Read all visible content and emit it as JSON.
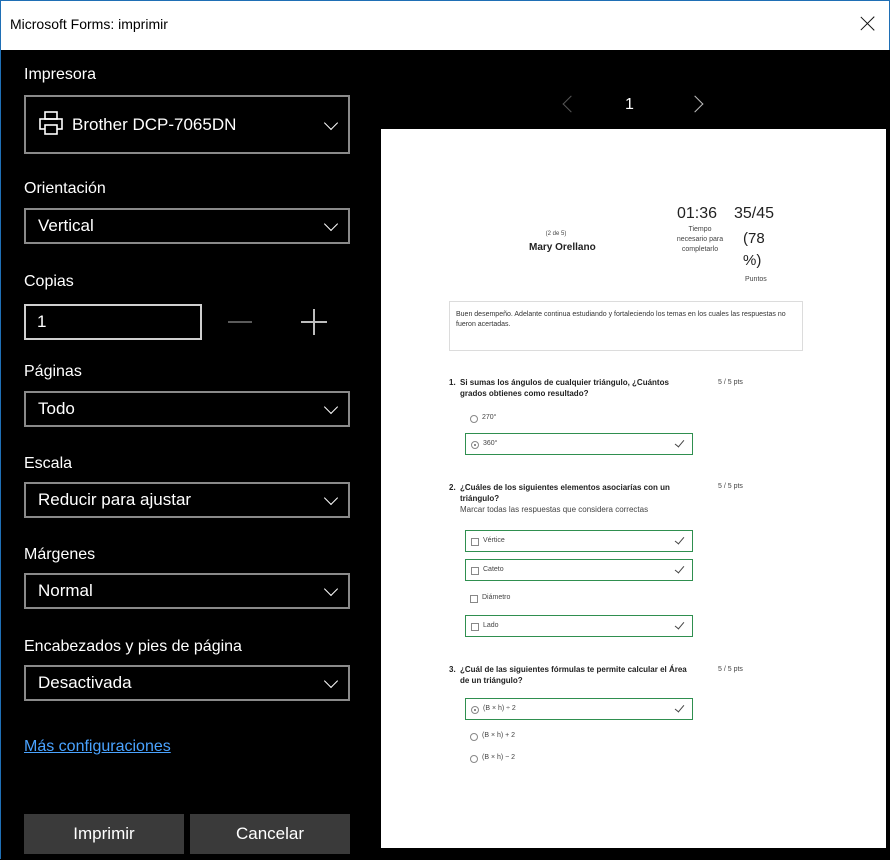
{
  "window": {
    "title": "Microsoft Forms: imprimir"
  },
  "settings": {
    "printer_label": "Impresora",
    "printer_value": "Brother DCP-7065DN",
    "orientation_label": "Orientación",
    "orientation_value": "Vertical",
    "copies_label": "Copias",
    "copies_value": "1",
    "pages_label": "Páginas",
    "pages_value": "Todo",
    "scale_label": "Escala",
    "scale_value": "Reducir para ajustar",
    "margins_label": "Márgenes",
    "margins_value": "Normal",
    "headers_label": "Encabezados y pies de página",
    "headers_value": "Desactivada",
    "more_settings": "Más configuraciones",
    "print_button": "Imprimir",
    "cancel_button": "Cancelar"
  },
  "preview": {
    "page_number": "1",
    "header": {
      "count": "(2 de 5)",
      "name": "Mary Orellano",
      "time": "01:36",
      "time_label": "Tiempo necesario para completarlo",
      "score": "35/45",
      "percent": "(78 %)",
      "points_label": "Puntos"
    },
    "feedback": "Buen desempeño. Adelante continua estudiando y fortaleciendo los temas en los cuales las respuestas no fueron acertadas.",
    "q1": {
      "num": "1.",
      "text": "Si sumas los ángulos de cualquier triángulo, ¿Cuántos grados obtienes como resultado?",
      "points": "5   / 5 pts",
      "options": [
        "270°",
        "360°"
      ]
    },
    "q2": {
      "num": "2.",
      "text": "¿Cuáles de los siguientes elementos asociarías con un triángulo?",
      "sub": "Marcar todas las respuestas que considera correctas",
      "points": "5   / 5 pts",
      "options": [
        "Vértice",
        "Cateto",
        "Diámetro",
        "Lado"
      ]
    },
    "q3": {
      "num": "3.",
      "text": "¿Cuál de las siguientes fórmulas te permite calcular el Área de un triángulo?",
      "points": "5   / 5 pts",
      "options": [
        "(B × h) ÷ 2",
        "(B × h) + 2",
        "(B × h) − 2"
      ]
    }
  }
}
